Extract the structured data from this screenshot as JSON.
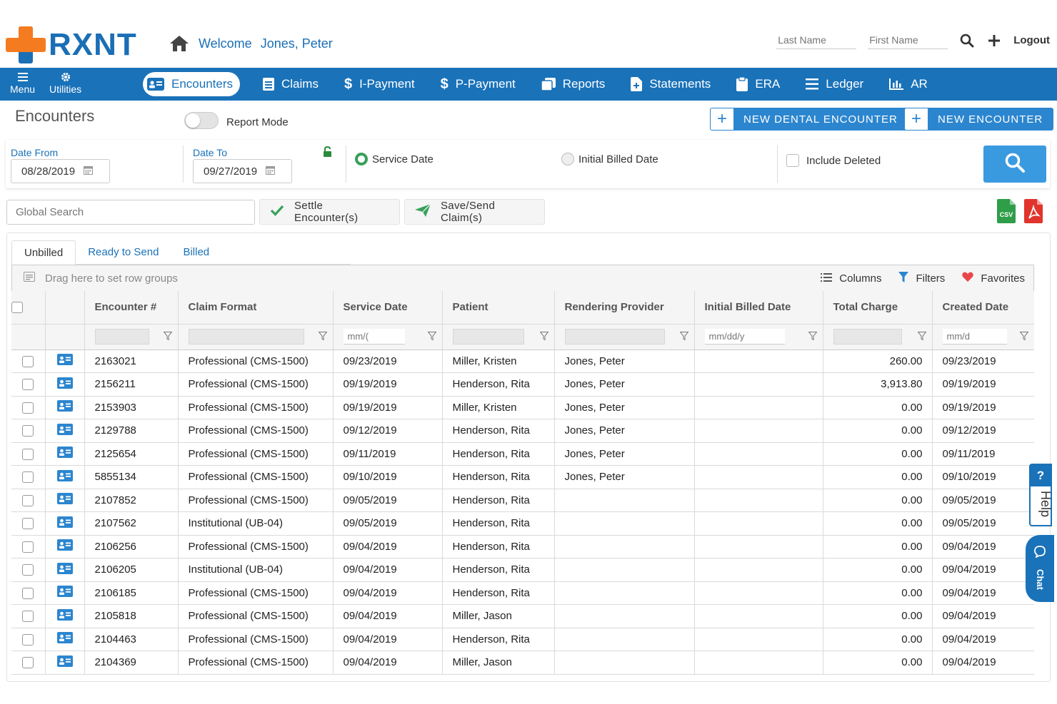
{
  "header": {
    "logo_text": "RXNT",
    "welcome_label": "Welcome",
    "user_name": "Jones, Peter",
    "last_name_placeholder": "Last Name",
    "first_name_placeholder": "First Name",
    "logout_label": "Logout"
  },
  "nav": {
    "menu_label": "Menu",
    "utilities_label": "Utilities",
    "items": [
      {
        "label": "Encounters",
        "icon": "id-card-icon",
        "active": true
      },
      {
        "label": "Claims",
        "icon": "document-icon"
      },
      {
        "label": "I-Payment",
        "icon": "dollar-icon"
      },
      {
        "label": "P-Payment",
        "icon": "dollar-icon"
      },
      {
        "label": "Reports",
        "icon": "copy-icon"
      },
      {
        "label": "Statements",
        "icon": "file-plus-icon"
      },
      {
        "label": "ERA",
        "icon": "clipboard-icon"
      },
      {
        "label": "Ledger",
        "icon": "list-icon"
      },
      {
        "label": "AR",
        "icon": "bar-chart-icon"
      }
    ]
  },
  "page": {
    "title": "Encounters",
    "report_mode_label": "Report Mode",
    "new_dental_label": "NEW DENTAL ENCOUNTER",
    "new_encounter_label": "NEW ENCOUNTER"
  },
  "filters": {
    "date_from_label": "Date From",
    "date_from_value": "08/28/2019",
    "date_to_label": "Date To",
    "date_to_value": "09/27/2019",
    "service_date_label": "Service Date",
    "initial_billed_label": "Initial Billed Date",
    "include_deleted_label": "Include Deleted",
    "selected_radio": "Service Date"
  },
  "actions": {
    "global_search_placeholder": "Global Search",
    "settle_label": "Settle Encounter(s)",
    "save_send_label": "Save/Send Claim(s)",
    "csv_label": "CSV"
  },
  "grid": {
    "tabs": [
      "Unbilled",
      "Ready to Send",
      "Billed"
    ],
    "active_tab": "Unbilled",
    "group_hint": "Drag here to set row groups",
    "columns_label": "Columns",
    "filters_label": "Filters",
    "favorites_label": "Favorites",
    "headers": [
      "Encounter #",
      "Claim Format",
      "Service Date",
      "Patient",
      "Rendering Provider",
      "Initial Billed Date",
      "Total Charge",
      "Created Date"
    ],
    "date_filter_placeholders": [
      "mm/(",
      "mm/dd/y",
      "mm/d"
    ],
    "rows": [
      [
        "2163021",
        "Professional (CMS-1500)",
        "09/23/2019",
        "Miller, Kristen",
        "Jones, Peter",
        "",
        "260.00",
        "09/23/2019"
      ],
      [
        "2156211",
        "Professional (CMS-1500)",
        "09/19/2019",
        "Henderson, Rita",
        "Jones, Peter",
        "",
        "3,913.80",
        "09/19/2019"
      ],
      [
        "2153903",
        "Professional (CMS-1500)",
        "09/19/2019",
        "Miller, Kristen",
        "Jones, Peter",
        "",
        "0.00",
        "09/19/2019"
      ],
      [
        "2129788",
        "Professional (CMS-1500)",
        "09/12/2019",
        "Henderson, Rita",
        "Jones, Peter",
        "",
        "0.00",
        "09/12/2019"
      ],
      [
        "2125654",
        "Professional (CMS-1500)",
        "09/11/2019",
        "Henderson, Rita",
        "Jones, Peter",
        "",
        "0.00",
        "09/11/2019"
      ],
      [
        "5855134",
        "Professional (CMS-1500)",
        "09/10/2019",
        "Henderson, Rita",
        "Jones, Peter",
        "",
        "0.00",
        "09/10/2019"
      ],
      [
        "2107852",
        "Professional (CMS-1500)",
        "09/05/2019",
        "Henderson, Rita",
        "",
        "",
        "0.00",
        "09/05/2019"
      ],
      [
        "2107562",
        "Institutional (UB-04)",
        "09/05/2019",
        "Henderson, Rita",
        "",
        "",
        "0.00",
        "09/05/2019"
      ],
      [
        "2106256",
        "Professional (CMS-1500)",
        "09/04/2019",
        "Henderson, Rita",
        "",
        "",
        "0.00",
        "09/04/2019"
      ],
      [
        "2106205",
        "Institutional (UB-04)",
        "09/04/2019",
        "Henderson, Rita",
        "",
        "",
        "0.00",
        "09/04/2019"
      ],
      [
        "2106185",
        "Professional (CMS-1500)",
        "09/04/2019",
        "Henderson, Rita",
        "",
        "",
        "0.00",
        "09/04/2019"
      ],
      [
        "2105818",
        "Professional (CMS-1500)",
        "09/04/2019",
        "Miller, Jason",
        "",
        "",
        "0.00",
        "09/04/2019"
      ],
      [
        "2104463",
        "Professional (CMS-1500)",
        "09/04/2019",
        "Henderson, Rita",
        "",
        "",
        "0.00",
        "09/04/2019"
      ],
      [
        "2104369",
        "Professional (CMS-1500)",
        "09/04/2019",
        "Miller, Jason",
        "",
        "",
        "0.00",
        "09/04/2019"
      ]
    ]
  },
  "side": {
    "help_q": "?",
    "help_label": "Help",
    "chat_label": "Chat"
  },
  "colors": {
    "brand_blue": "#1a72b9",
    "brand_orange": "#f47b20",
    "button_blue": "#2c86cf",
    "search_blue": "#3a9ae0",
    "success_green": "#39a05a"
  }
}
